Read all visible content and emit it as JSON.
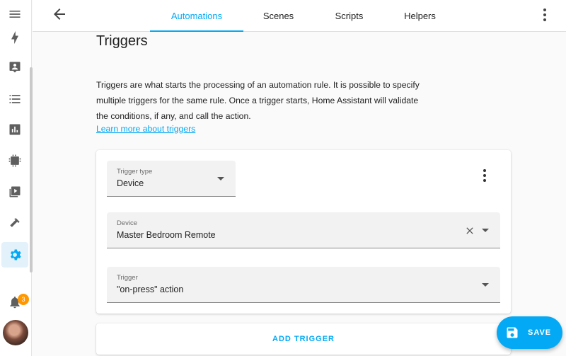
{
  "sidebar": {
    "items": [
      {
        "icon": "menu-icon"
      },
      {
        "icon": "lightning-bolt-icon"
      },
      {
        "icon": "account-box-icon"
      },
      {
        "icon": "format-list-icon"
      },
      {
        "icon": "chart-box-icon"
      },
      {
        "icon": "chip-icon"
      },
      {
        "icon": "play-box-icon"
      },
      {
        "icon": "hammer-icon"
      },
      {
        "icon": "cog-icon",
        "active": true
      }
    ],
    "notification_count": "3"
  },
  "header": {
    "tabs": [
      {
        "label": "Automations",
        "active": true
      },
      {
        "label": "Scenes"
      },
      {
        "label": "Scripts"
      },
      {
        "label": "Helpers"
      }
    ]
  },
  "main": {
    "title": "Triggers",
    "description": "Triggers are what starts the processing of an automation rule. It is possible to specify multiple triggers for the same rule. Once a trigger starts, Home Assistant will validate the conditions, if any, and call the action.",
    "learn_more": "Learn more about triggers",
    "trigger": {
      "type_label": "Trigger type",
      "type_value": "Device",
      "device_label": "Device",
      "device_value": "Master Bedroom Remote",
      "trigger_label": "Trigger",
      "trigger_value": "\"on-press\" action"
    },
    "add_trigger": "ADD TRIGGER",
    "save": "SAVE"
  },
  "colors": {
    "accent": "#03a9f4",
    "badge": "#ff9800"
  }
}
